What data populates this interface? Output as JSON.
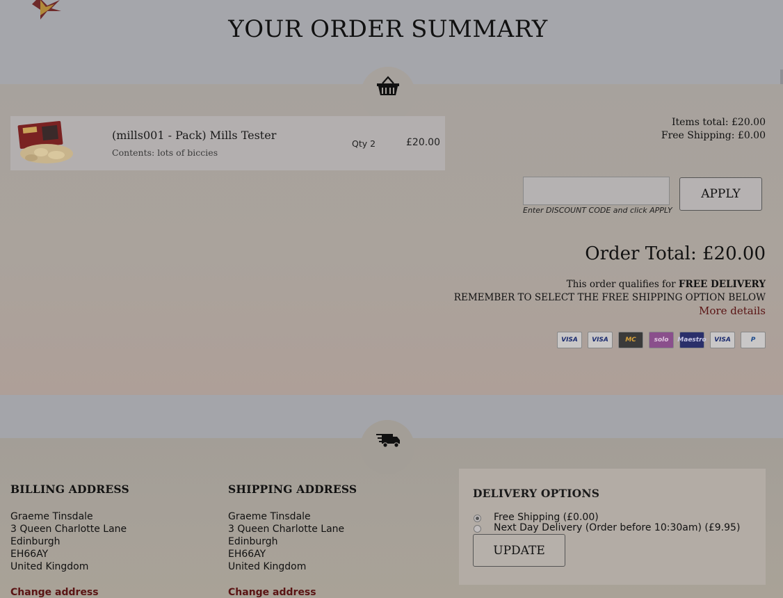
{
  "page": {
    "title": "YOUR ORDER SUMMARY"
  },
  "basket": {
    "items": [
      {
        "name": "(mills001 - Pack) Mills Tester",
        "contents": "Contents: lots of biccies",
        "qty": "Qty 2",
        "price": "£20.00"
      }
    ]
  },
  "totals": {
    "items_total": "Items total: £20.00",
    "shipping": "Free Shipping: £0.00",
    "order_total": "Order Total: £20.00"
  },
  "discount": {
    "hint": "Enter DISCOUNT CODE and click APPLY",
    "apply_label": "APPLY",
    "value": ""
  },
  "delivery_note": {
    "prefix": "This order qualifies for ",
    "emphasis": "FREE DELIVERY",
    "reminder": "REMEMBER TO SELECT THE FREE SHIPPING OPTION BELOW",
    "more_link": "More details"
  },
  "payment_icons": [
    {
      "icon": "visa-icon",
      "label": "VISA",
      "bg": "#c9c7c7",
      "fg": "#1a2a6e"
    },
    {
      "icon": "visa-electron-icon",
      "label": "VISA",
      "bg": "#c9c7c7",
      "fg": "#1a2a6e"
    },
    {
      "icon": "mastercard-icon",
      "label": "MC",
      "bg": "#3a3a3a",
      "fg": "#d7a23c"
    },
    {
      "icon": "solo-icon",
      "label": "solo",
      "bg": "#8a4f8c",
      "fg": "#e0c8e0"
    },
    {
      "icon": "maestro-icon",
      "label": "Maestro",
      "bg": "#2a2f6a",
      "fg": "#c9c9e6"
    },
    {
      "icon": "visa-debit-icon",
      "label": "VISA",
      "bg": "#c9c7c7",
      "fg": "#1a2a6e"
    },
    {
      "icon": "paypal-icon",
      "label": "P",
      "bg": "#c9c7c7",
      "fg": "#1c4a8c"
    }
  ],
  "billing": {
    "heading": "BILLING ADDRESS",
    "lines": [
      "Graeme Tinsdale",
      "3 Queen Charlotte Lane",
      "Edinburgh",
      "EH66AY",
      "United Kingdom"
    ],
    "change_label": "Change address"
  },
  "shipping": {
    "heading": "SHIPPING ADDRESS",
    "lines": [
      "Graeme Tinsdale",
      "3 Queen Charlotte Lane",
      "Edinburgh",
      "EH66AY",
      "United Kingdom"
    ],
    "change_label": "Change address"
  },
  "delivery_options": {
    "heading": "DELIVERY OPTIONS",
    "options": [
      {
        "label": "Free Shipping (£0.00)",
        "checked": true
      },
      {
        "label": "Next Day Delivery (Order before 10:30am) (£9.95)",
        "checked": false
      }
    ],
    "update_label": "UPDATE"
  }
}
